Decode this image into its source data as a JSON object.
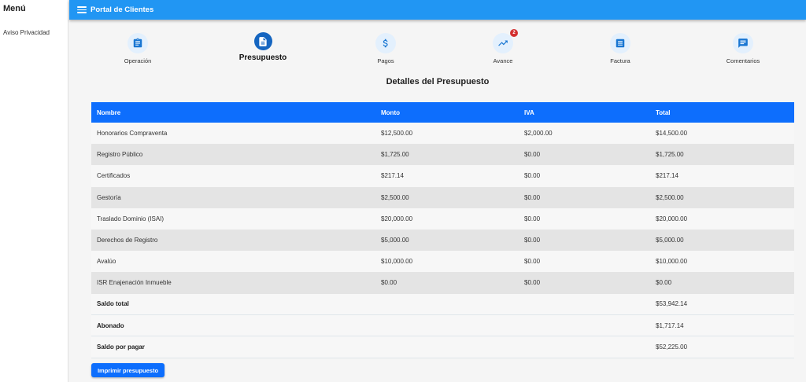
{
  "sidebar": {
    "title": "Menú",
    "items": [
      {
        "label": "Aviso Privacidad"
      }
    ]
  },
  "header": {
    "title": "Portal de Clientes"
  },
  "steps": [
    {
      "label": "Operación",
      "icon": "assignment-icon",
      "active": false
    },
    {
      "label": "Presupuesto",
      "icon": "description-icon",
      "active": true
    },
    {
      "label": "Pagos",
      "icon": "dollar-icon",
      "active": false
    },
    {
      "label": "Avance",
      "icon": "trending-up-icon",
      "active": false,
      "badge": "2"
    },
    {
      "label": "Factura",
      "icon": "receipt-icon",
      "active": false
    },
    {
      "label": "Comentarios",
      "icon": "chat-icon",
      "active": false
    }
  ],
  "section_title": "Detalles del Presupuesto",
  "table": {
    "columns": [
      "Nombre",
      "Monto",
      "IVA",
      "Total"
    ],
    "rows": [
      [
        "Honorarios Compraventa",
        "$12,500.00",
        "$2,000.00",
        "$14,500.00"
      ],
      [
        "Registro Público",
        "$1,725.00",
        "$0.00",
        "$1,725.00"
      ],
      [
        "Certificados",
        "$217.14",
        "$0.00",
        "$217.14"
      ],
      [
        "Gestoría",
        "$2,500.00",
        "$0.00",
        "$2,500.00"
      ],
      [
        "Traslado Dominio (ISAI)",
        "$20,000.00",
        "$0.00",
        "$20,000.00"
      ],
      [
        "Derechos de Registro",
        "$5,000.00",
        "$0.00",
        "$5,000.00"
      ],
      [
        "Avalúo",
        "$10,000.00",
        "$0.00",
        "$10,000.00"
      ],
      [
        "ISR Enajenación Inmueble",
        "$0.00",
        "$0.00",
        "$0.00"
      ]
    ],
    "summary": [
      {
        "label": "Saldo total",
        "value": "$53,942.14"
      },
      {
        "label": "Abonado",
        "value": "$1,717.14"
      },
      {
        "label": "Saldo por pagar",
        "value": "$52,225.00"
      }
    ]
  },
  "print_button": "Imprimir presupuesto",
  "colors": {
    "primary": "#2196f3",
    "accent": "#0d6efd",
    "badge": "#d32f2f"
  }
}
